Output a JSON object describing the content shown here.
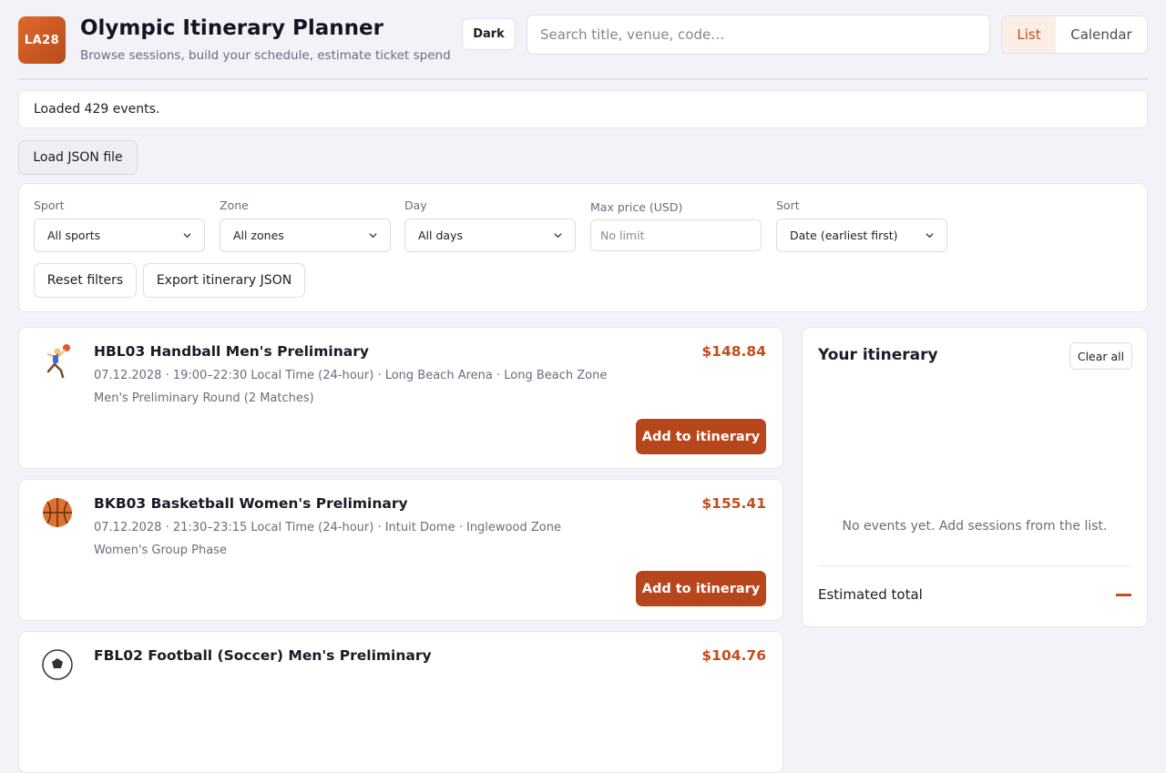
{
  "header": {
    "logo_text": "LA28",
    "title": "Olympic Itinerary Planner",
    "subtitle": "Browse sessions, build your schedule, estimate ticket spend",
    "theme_button": "Dark",
    "search_placeholder": "Search title, venue, code…",
    "view_tabs": [
      "List",
      "Calendar"
    ],
    "active_view": "List"
  },
  "status": {
    "message": "Loaded 429 events."
  },
  "load_button": "Load JSON file",
  "filters": {
    "sport": {
      "label": "Sport",
      "value": "All sports"
    },
    "zone": {
      "label": "Zone",
      "value": "All zones"
    },
    "day": {
      "label": "Day",
      "value": "All days"
    },
    "max_price": {
      "label": "Max price (USD)",
      "placeholder": "No limit"
    },
    "sort": {
      "label": "Sort",
      "value": "Date (earliest first)"
    },
    "reset_button": "Reset filters",
    "export_button": "Export itinerary JSON"
  },
  "events": [
    {
      "icon": "handball-player-icon",
      "title": "HBL03 Handball Men's Preliminary",
      "meta": "07.12.2028 · 19:00–22:30 Local Time (24-hour) · Long Beach Arena · Long Beach Zone",
      "sub": "Men's Preliminary Round (2 Matches)",
      "price": "$148.84",
      "button": "Add to itinerary"
    },
    {
      "icon": "basketball-icon",
      "title": "BKB03 Basketball Women's Preliminary",
      "meta": "07.12.2028 · 21:30–23:15 Local Time (24-hour) · Intuit Dome · Inglewood Zone",
      "sub": "Women's Group Phase",
      "price": "$155.41",
      "button": "Add to itinerary"
    },
    {
      "icon": "soccer-ball-icon",
      "title": "FBL02 Football (Soccer) Men's Preliminary",
      "price": "$104.76"
    }
  ],
  "itinerary": {
    "title": "Your itinerary",
    "clear_button": "Clear all",
    "empty_message": "No events yet. Add sessions from the list.",
    "total_label": "Estimated total",
    "total_value": "—"
  },
  "colors": {
    "accent": "#c24e1e",
    "button": "#b8461d",
    "background": "#f2f2f8"
  }
}
